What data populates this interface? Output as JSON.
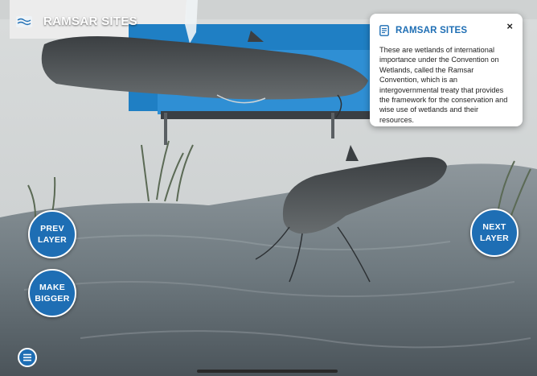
{
  "app": {
    "title": "RAMSAR SITES"
  },
  "info_card": {
    "title": "RAMSAR SITES",
    "close_label": "×",
    "description": "These are wetlands of international importance under the Convention on Wetlands, called the Ramsar Convention, which is an intergovernmental treaty that provides the framework for the conservation and wise use of wetlands and their resources."
  },
  "controls": {
    "prev_layer": {
      "line1": "PREV",
      "line2": "LAYER"
    },
    "make_bigger": {
      "line1": "MAKE",
      "line2": "BIGGER"
    },
    "next_layer": {
      "line1": "NEXT",
      "line2": "LAYER"
    }
  },
  "icons": {
    "logo": "ramsar-logo-icon",
    "card": "document-icon",
    "close": "close-icon",
    "menu": "menu-icon"
  },
  "colors": {
    "accent": "#1e6eb4",
    "card_title": "#1e6eb4",
    "button_border": "#ffffff"
  }
}
